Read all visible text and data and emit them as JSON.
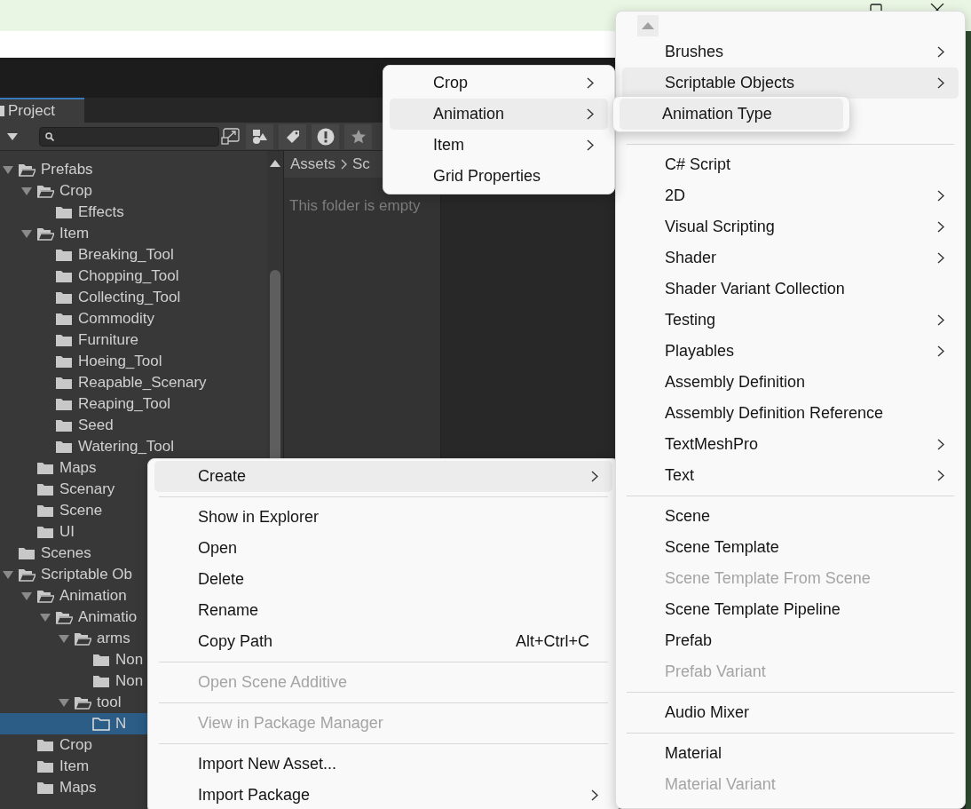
{
  "project_tab": {
    "label": "Project",
    "selected": true
  },
  "tree": [
    {
      "label": "Prefabs",
      "expanded": true,
      "selected": false,
      "children": [
        {
          "label": "Crop",
          "expanded": true,
          "selected": false,
          "children": [
            {
              "label": "Effects",
              "selected": false
            }
          ]
        },
        {
          "label": "Item",
          "expanded": true,
          "selected": false,
          "children": [
            {
              "label": "Breaking_Tool",
              "selected": false
            },
            {
              "label": "Chopping_Tool",
              "selected": false
            },
            {
              "label": "Collecting_Tool",
              "selected": false
            },
            {
              "label": "Commodity",
              "selected": false
            },
            {
              "label": "Furniture",
              "selected": false
            },
            {
              "label": "Hoeing_Tool",
              "selected": false
            },
            {
              "label": "Reapable_Scenary",
              "selected": false
            },
            {
              "label": "Reaping_Tool",
              "selected": false
            },
            {
              "label": "Seed",
              "selected": false
            },
            {
              "label": "Watering_Tool",
              "selected": false
            }
          ]
        },
        {
          "label": "Maps",
          "selected": false
        },
        {
          "label": "Scenary",
          "selected": false
        },
        {
          "label": "Scene",
          "selected": false
        },
        {
          "label": "UI",
          "selected": false
        }
      ]
    },
    {
      "label": "Scenes",
      "selected": false
    },
    {
      "label": "Scriptable Ob",
      "expanded": true,
      "selected": false,
      "children": [
        {
          "label": "Animation",
          "expanded": true,
          "selected": false,
          "children": [
            {
              "label": "Animatio",
              "expanded": true,
              "selected": false,
              "children": [
                {
                  "label": "arms",
                  "expanded": true,
                  "selected": false,
                  "children": [
                    {
                      "label": "Non",
                      "selected": false
                    },
                    {
                      "label": "Non",
                      "selected": false
                    }
                  ]
                },
                {
                  "label": "tool",
                  "expanded": true,
                  "selected": false,
                  "children": [
                    {
                      "label": "N",
                      "selected": true,
                      "empty": true
                    }
                  ]
                }
              ]
            }
          ]
        },
        {
          "label": "Crop",
          "selected": false
        },
        {
          "label": "Item",
          "selected": false
        },
        {
          "label": "Maps",
          "selected": false
        }
      ]
    }
  ],
  "breadcrumb": [
    "Assets",
    "Sc"
  ],
  "empty_message": "This folder is empty",
  "context_menu": [
    {
      "kind": "item",
      "label": "Create",
      "highlighted": true,
      "disabled": false,
      "submenu": true
    },
    {
      "kind": "separator"
    },
    {
      "kind": "item",
      "label": "Show in Explorer",
      "highlighted": false,
      "disabled": false,
      "submenu": false
    },
    {
      "kind": "item",
      "label": "Open",
      "highlighted": false,
      "disabled": false,
      "submenu": false
    },
    {
      "kind": "item",
      "label": "Delete",
      "highlighted": false,
      "disabled": false,
      "submenu": false
    },
    {
      "kind": "item",
      "label": "Rename",
      "highlighted": false,
      "disabled": false,
      "submenu": false
    },
    {
      "kind": "item",
      "label": "Copy Path",
      "shortcut": "Alt+Ctrl+C",
      "highlighted": false,
      "disabled": false,
      "submenu": false
    },
    {
      "kind": "separator"
    },
    {
      "kind": "item",
      "label": "Open Scene Additive",
      "highlighted": false,
      "disabled": true,
      "submenu": false
    },
    {
      "kind": "separator"
    },
    {
      "kind": "item",
      "label": "View in Package Manager",
      "highlighted": false,
      "disabled": true,
      "submenu": false
    },
    {
      "kind": "separator"
    },
    {
      "kind": "item",
      "label": "Import New Asset...",
      "highlighted": false,
      "disabled": false,
      "submenu": false
    },
    {
      "kind": "item",
      "label": "Import Package",
      "highlighted": false,
      "disabled": false,
      "submenu": true
    }
  ],
  "create_menu": [
    {
      "kind": "item",
      "label": "Brushes",
      "highlighted": false,
      "disabled": false,
      "submenu": true
    },
    {
      "kind": "item",
      "label": "Scriptable Objects",
      "highlighted": true,
      "disabled": false,
      "submenu": true
    },
    {
      "kind": "separator"
    },
    {
      "kind": "item",
      "label": "C# Script",
      "highlighted": false,
      "disabled": false,
      "submenu": false
    },
    {
      "kind": "item",
      "label": "2D",
      "highlighted": false,
      "disabled": false,
      "submenu": true
    },
    {
      "kind": "item",
      "label": "Visual Scripting",
      "highlighted": false,
      "disabled": false,
      "submenu": true
    },
    {
      "kind": "item",
      "label": "Shader",
      "highlighted": false,
      "disabled": false,
      "submenu": true
    },
    {
      "kind": "item",
      "label": "Shader Variant Collection",
      "highlighted": false,
      "disabled": false,
      "submenu": false
    },
    {
      "kind": "item",
      "label": "Testing",
      "highlighted": false,
      "disabled": false,
      "submenu": true
    },
    {
      "kind": "item",
      "label": "Playables",
      "highlighted": false,
      "disabled": false,
      "submenu": true
    },
    {
      "kind": "item",
      "label": "Assembly Definition",
      "highlighted": false,
      "disabled": false,
      "submenu": false
    },
    {
      "kind": "item",
      "label": "Assembly Definition Reference",
      "highlighted": false,
      "disabled": false,
      "submenu": false
    },
    {
      "kind": "item",
      "label": "TextMeshPro",
      "highlighted": false,
      "disabled": false,
      "submenu": true
    },
    {
      "kind": "item",
      "label": "Text",
      "highlighted": false,
      "disabled": false,
      "submenu": true
    },
    {
      "kind": "separator"
    },
    {
      "kind": "item",
      "label": "Scene",
      "highlighted": false,
      "disabled": false,
      "submenu": false
    },
    {
      "kind": "item",
      "label": "Scene Template",
      "highlighted": false,
      "disabled": false,
      "submenu": false
    },
    {
      "kind": "item",
      "label": "Scene Template From Scene",
      "highlighted": false,
      "disabled": true,
      "submenu": false
    },
    {
      "kind": "item",
      "label": "Scene Template Pipeline",
      "highlighted": false,
      "disabled": false,
      "submenu": false
    },
    {
      "kind": "item",
      "label": "Prefab",
      "highlighted": false,
      "disabled": false,
      "submenu": false
    },
    {
      "kind": "item",
      "label": "Prefab Variant",
      "highlighted": false,
      "disabled": true,
      "submenu": false
    },
    {
      "kind": "separator"
    },
    {
      "kind": "item",
      "label": "Audio Mixer",
      "highlighted": false,
      "disabled": false,
      "submenu": false
    },
    {
      "kind": "separator"
    },
    {
      "kind": "item",
      "label": "Material",
      "highlighted": false,
      "disabled": false,
      "submenu": false
    },
    {
      "kind": "item",
      "label": "Material Variant",
      "highlighted": false,
      "disabled": true,
      "submenu": false
    }
  ],
  "scriptable_objects_menu": [
    {
      "kind": "item",
      "label": "Crop",
      "highlighted": false,
      "disabled": false,
      "submenu": true
    },
    {
      "kind": "item",
      "label": "Animation",
      "highlighted": true,
      "disabled": false,
      "submenu": true
    },
    {
      "kind": "item",
      "label": "Item",
      "highlighted": false,
      "disabled": false,
      "submenu": true
    },
    {
      "kind": "item",
      "label": "Grid Properties",
      "highlighted": false,
      "disabled": false,
      "submenu": false
    }
  ],
  "animation_menu": [
    {
      "kind": "item",
      "label": "Animation Type",
      "highlighted": true,
      "disabled": false,
      "submenu": false
    }
  ]
}
